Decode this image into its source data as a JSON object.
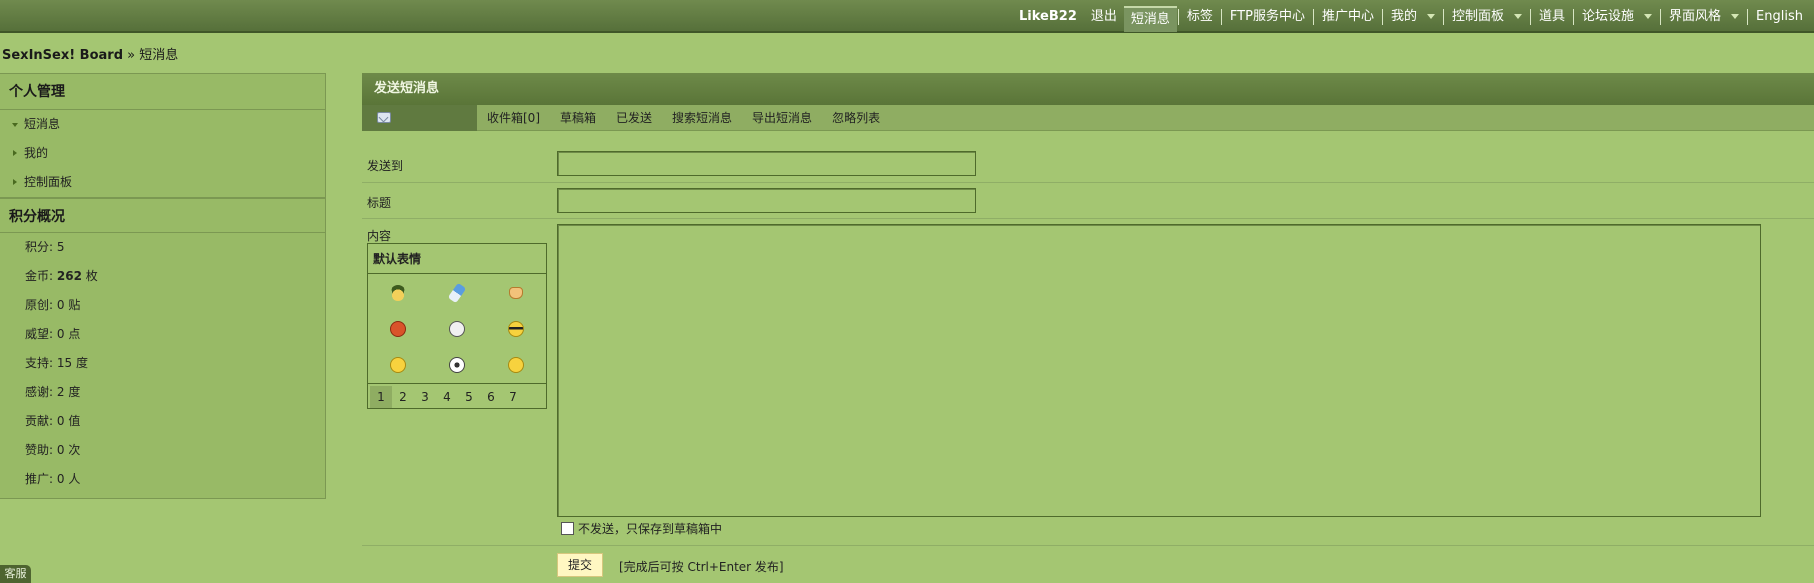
{
  "topnav": {
    "username": "LikeB22",
    "logout": "退出",
    "messages": "短消息",
    "tags": "标签",
    "ftp": "FTP服务中心",
    "promo": "推广中心",
    "mine": "我的",
    "control_panel": "控制面板",
    "tools": "道具",
    "forum_settings": "论坛设施",
    "theme": "界面风格",
    "english": "English"
  },
  "breadcrumb": {
    "board": "SexInSex! Board",
    "separator": " » ",
    "current": "短消息"
  },
  "sidebar": {
    "personal_title": "个人管理",
    "menu": [
      {
        "label": "短消息",
        "active": true
      },
      {
        "label": "我的",
        "active": false
      },
      {
        "label": "控制面板",
        "active": false
      }
    ],
    "stats_title": "积分概况",
    "stats": [
      {
        "label": "积分:",
        "value": "5",
        "unit": ""
      },
      {
        "label": "金币:",
        "value": "262",
        "unit": "枚"
      },
      {
        "label": "原创:",
        "value": "0",
        "unit": "贴"
      },
      {
        "label": "威望:",
        "value": "0",
        "unit": "点"
      },
      {
        "label": "支持:",
        "value": "15",
        "unit": "度"
      },
      {
        "label": "感谢:",
        "value": "2",
        "unit": "度"
      },
      {
        "label": "贡献:",
        "value": "0",
        "unit": "值"
      },
      {
        "label": "赞助:",
        "value": "0",
        "unit": "次"
      },
      {
        "label": "推广:",
        "value": "0",
        "unit": "人"
      }
    ]
  },
  "panel": {
    "title": "发送短消息",
    "tabs": [
      "收件箱[0]",
      "草稿箱",
      "已发送",
      "搜索短消息",
      "导出短消息",
      "忽略列表"
    ]
  },
  "form": {
    "to_label": "发送到",
    "to_value": "",
    "subject_label": "标题",
    "subject_value": "",
    "content_label": "内容",
    "content_value": "",
    "draft_label": "不发送，只保存到草稿箱中",
    "submit_label": "提交",
    "submit_hint": "[完成后可按 Ctrl+Enter 发布]"
  },
  "smilies": {
    "title": "默认表情",
    "icons": [
      "soldier-smiley-icon",
      "pill-smiley-icon",
      "thumbs-up-icon",
      "devil-smiley-icon",
      "skull-icon",
      "cool-smiley-icon",
      "frown-smiley-icon",
      "soccer-ball-icon",
      "sleepy-smiley-icon"
    ],
    "pages": [
      "1",
      "2",
      "3",
      "4",
      "5",
      "6",
      "7"
    ],
    "current_page": "1"
  },
  "kefu": "客服"
}
